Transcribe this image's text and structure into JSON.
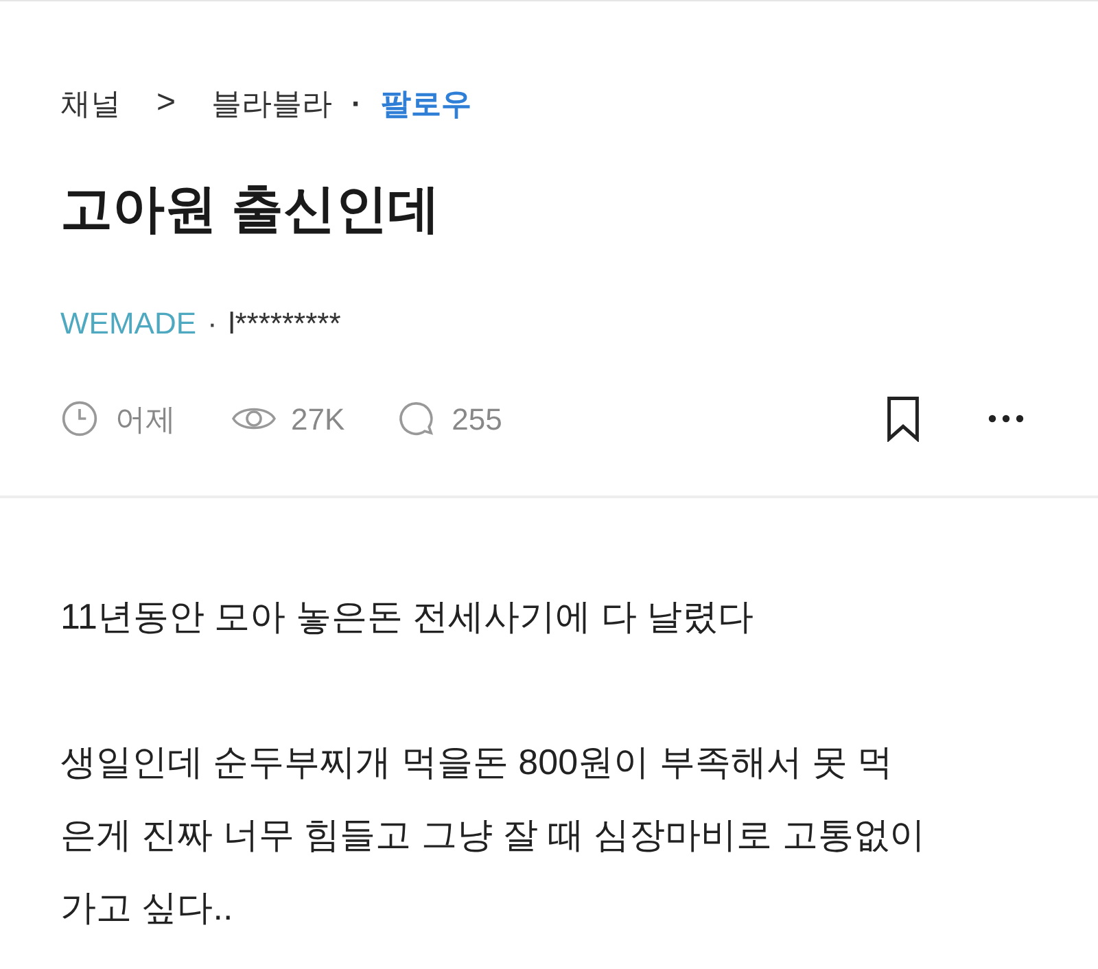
{
  "breadcrumb": {
    "channel": "채널",
    "separator": ">",
    "board": "블라블라",
    "dot": "·",
    "follow": "팔로우"
  },
  "title": "고아원 출신인데",
  "author": {
    "company": "WEMADE",
    "dot": "·",
    "name": "l*********"
  },
  "meta": {
    "time": "어제",
    "views": "27K",
    "comments": "255",
    "bookmarked": false
  },
  "body": [
    "11년동안 모아 놓은돈 전세사기에 다 날렸다",
    "생일인데 순두부찌개 먹을돈 800원이 부족해서 못 먹은게 진짜 너무 힘들고 그냥 잘 때 심장마비로 고통없이 가고 싶다.."
  ]
}
